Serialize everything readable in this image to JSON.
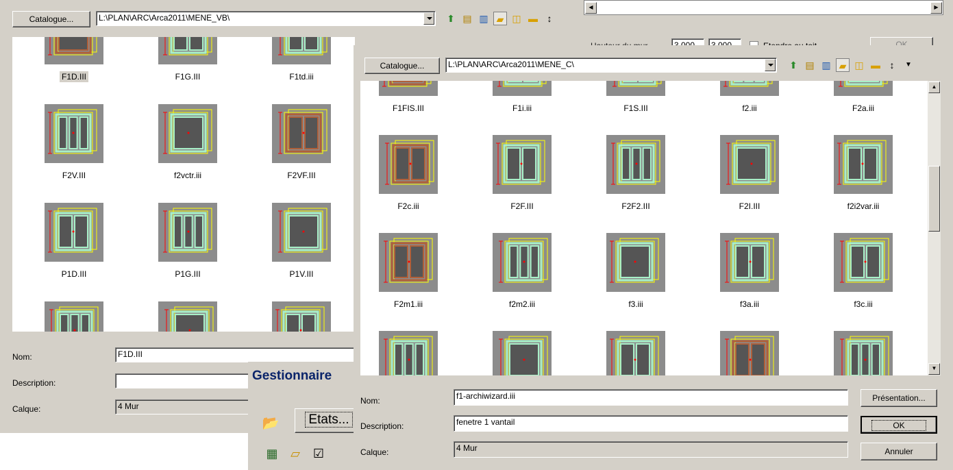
{
  "back_dialog": {
    "catalogue_button": "Catalogue...",
    "path": "L:\\PLAN\\ARC\\Arca2011\\MENE_VB\\",
    "items": [
      {
        "name": "F1D.III",
        "selected": true
      },
      {
        "name": "F1G.III"
      },
      {
        "name": "F1td.iii"
      },
      {
        "name": "F2V.III"
      },
      {
        "name": "f2vctr.iii"
      },
      {
        "name": "F2VF.III"
      },
      {
        "name": "P1D.III"
      },
      {
        "name": "P1G.III"
      },
      {
        "name": "P1V.III"
      }
    ],
    "nom_label": "Nom:",
    "nom_value": "F1D.III",
    "description_label": "Description:",
    "description_value": "",
    "calque_label": "Calque:",
    "calque_value": "4 Mur"
  },
  "top_right_dialog": {
    "hauteur_label": "Hauteur du mur",
    "h1": "3,000",
    "h2": "3,000",
    "etendre_label": "Etendre au toit",
    "ok_label": "OK"
  },
  "gestionnaire": {
    "title": "Gestionnaire",
    "etats_button": "Etats..."
  },
  "front_dialog": {
    "catalogue_button": "Catalogue...",
    "path": "L:\\PLAN\\ARC\\Arca2011\\MENE_C\\",
    "items": [
      {
        "name": "F1FIS.III"
      },
      {
        "name": "F1i.iii"
      },
      {
        "name": "F1S.III"
      },
      {
        "name": "f2.iii"
      },
      {
        "name": "F2a.iii"
      },
      {
        "name": "F2c.iii"
      },
      {
        "name": "F2F.III"
      },
      {
        "name": "F2F2.III"
      },
      {
        "name": "F2I.III"
      },
      {
        "name": "f2i2var.iii"
      },
      {
        "name": "F2m1.iii"
      },
      {
        "name": "f2m2.iii"
      },
      {
        "name": "f3.iii"
      },
      {
        "name": "f3a.iii"
      },
      {
        "name": "f3c.iii"
      }
    ],
    "nom_label": "Nom:",
    "nom_value": "f1-archiwizard.iii",
    "description_label": "Description:",
    "description_value": "fenetre 1 vantail",
    "calque_label": "Calque:",
    "calque_value": "4 Mur",
    "presentation_button": "Présentation...",
    "ok_button": "OK",
    "annuler_button": "Annuler"
  },
  "icons": [
    "up-folder-icon",
    "print-icon",
    "book-icon",
    "open-folder-icon",
    "browse-folder-icon",
    "folder-icon",
    "sort-icon",
    "dropdown-arrow-icon"
  ],
  "colors": {
    "dialog_bg": "#d4d0c8",
    "thumb_bg": "#8c8c8c",
    "frame_yellow": "#ffff00",
    "frame_green": "#a8f0c8",
    "dim_red": "#ff0000",
    "frame_brown": "#b0603a"
  }
}
